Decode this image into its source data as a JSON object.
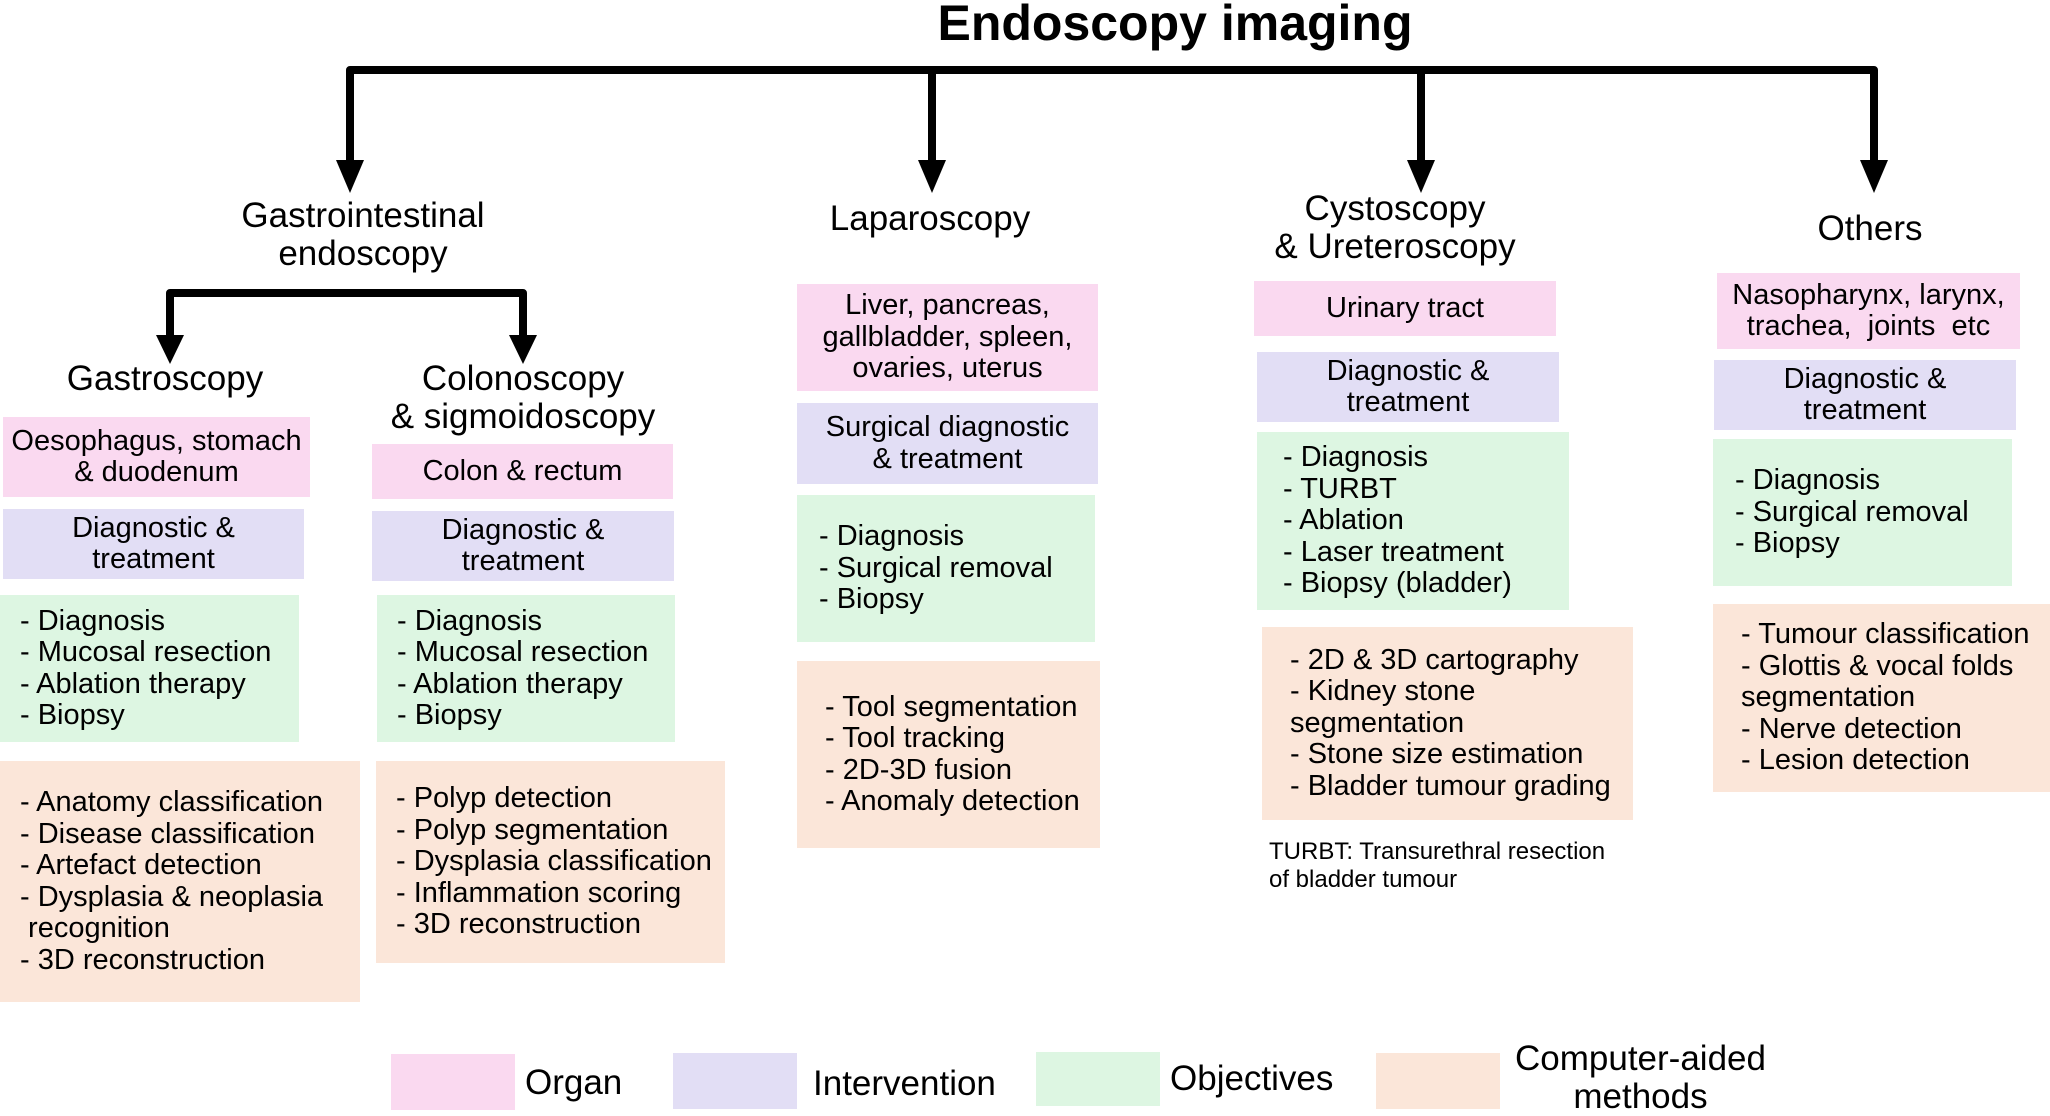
{
  "title": "Endoscopy imaging",
  "categories": [
    {
      "label": "Gastrointestinal endoscopy",
      "lines": [
        "Gastrointestinal",
        "endoscopy"
      ]
    },
    {
      "label": "Laparoscopy",
      "lines": [
        "Laparoscopy"
      ]
    },
    {
      "label": "Cystoscopy & Ureteroscopy",
      "lines": [
        "Cystoscopy",
        "& Ureteroscopy"
      ]
    },
    {
      "label": "Others",
      "lines": [
        "Others"
      ]
    }
  ],
  "subcategories": [
    {
      "label": "Gastroscopy",
      "lines": [
        "Gastroscopy"
      ]
    },
    {
      "label": "Colonoscopy & sigmoidoscopy",
      "lines": [
        "Colonoscopy",
        "& sigmoidoscopy"
      ]
    }
  ],
  "columns": {
    "gastroscopy": {
      "organ": [
        "Oesophagus, stomach",
        "& duodenum"
      ],
      "intervention": [
        "Diagnostic &",
        "treatment"
      ],
      "objectives": [
        "- Diagnosis",
        "- Mucosal resection",
        "- Ablation therapy",
        "- Biopsy"
      ],
      "methods": [
        "- Anatomy classification",
        "- Disease classification",
        "- Artefact detection",
        "- Dysplasia & neoplasia",
        " recognition",
        "- 3D reconstruction"
      ]
    },
    "colonoscopy": {
      "organ": [
        "Colon & rectum"
      ],
      "intervention": [
        "Diagnostic &",
        "treatment"
      ],
      "objectives": [
        "- Diagnosis",
        "- Mucosal resection",
        "- Ablation therapy",
        "- Biopsy"
      ],
      "methods": [
        "- Polyp detection",
        "- Polyp segmentation",
        "- Dysplasia classification",
        "- Inflammation scoring",
        "- 3D reconstruction"
      ]
    },
    "laparoscopy": {
      "organ": [
        "Liver, pancreas,",
        "gallbladder, spleen,",
        "ovaries, uterus"
      ],
      "intervention": [
        "Surgical diagnostic",
        "& treatment"
      ],
      "objectives": [
        "- Diagnosis",
        "- Surgical removal",
        "- Biopsy"
      ],
      "methods": [
        "- Tool segmentation",
        "- Tool tracking",
        "- 2D-3D fusion",
        "- Anomaly detection"
      ]
    },
    "cystoscopy": {
      "organ": [
        "Urinary tract"
      ],
      "intervention": [
        "Diagnostic &",
        "treatment"
      ],
      "objectives": [
        "- Diagnosis",
        "- TURBT",
        "- Ablation",
        "- Laser treatment",
        "- Biopsy (bladder)"
      ],
      "methods": [
        "- 2D & 3D cartography",
        "- Kidney stone",
        "segmentation",
        "- Stone size estimation",
        "- Bladder tumour grading"
      ],
      "note": [
        "TURBT: Transurethral resection",
        "of bladder tumour"
      ]
    },
    "others": {
      "organ": [
        "Nasopharynx, larynx,",
        "trachea,  joints  etc"
      ],
      "intervention": [
        "Diagnostic &",
        "treatment"
      ],
      "objectives": [
        "- Diagnosis",
        "- Surgical removal",
        "- Biopsy"
      ],
      "methods": [
        "- Tumour classification",
        "- Glottis & vocal folds",
        "segmentation",
        "- Nerve detection",
        "- Lesion detection"
      ]
    }
  },
  "legend": [
    {
      "label": "Organ",
      "lines": [
        "Organ"
      ],
      "color": "#fad9f0"
    },
    {
      "label": "Intervention",
      "lines": [
        "Intervention"
      ],
      "color": "#e2def5"
    },
    {
      "label": "Objectives",
      "lines": [
        "Objectives"
      ],
      "color": "#ddf6e2"
    },
    {
      "label": "Computer-aided methods",
      "lines": [
        "Computer-aided",
        "methods"
      ],
      "color": "#fbe6d9"
    }
  ]
}
